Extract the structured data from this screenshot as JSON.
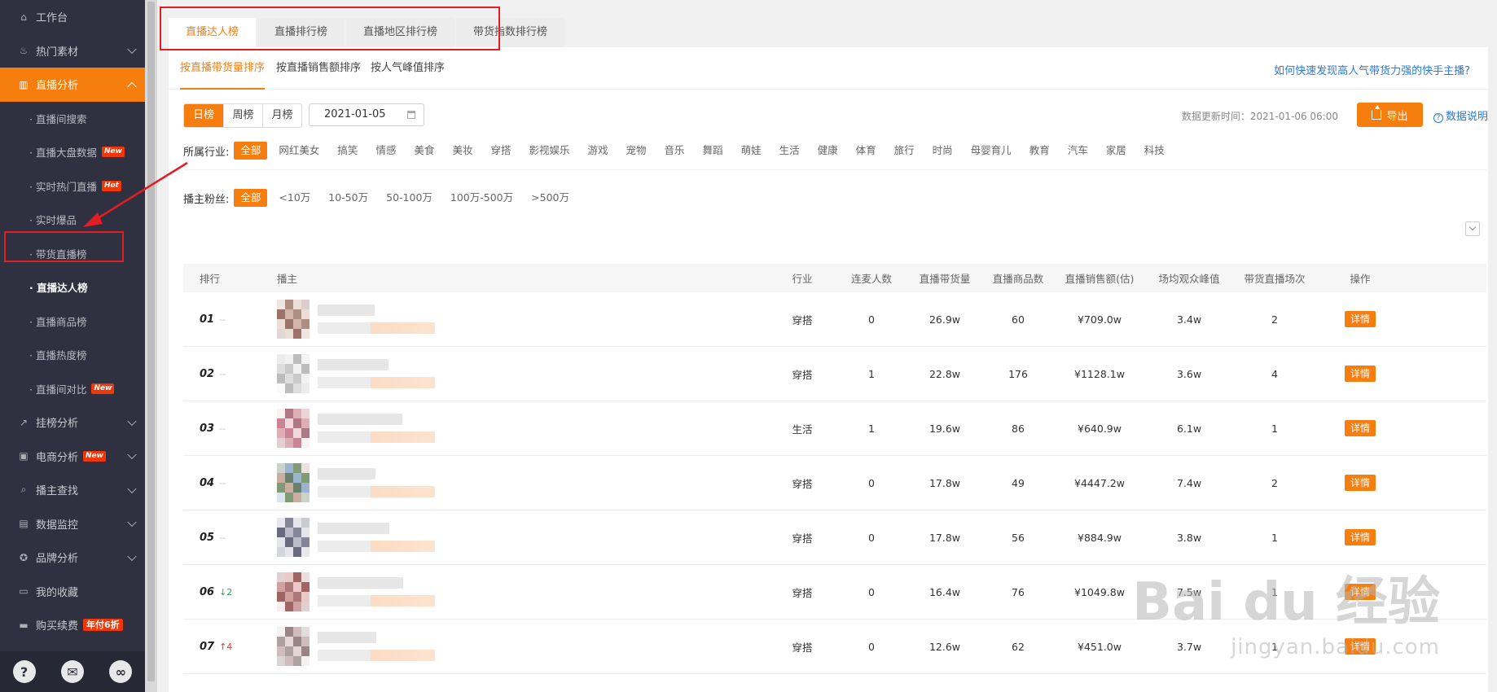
{
  "sidebar": {
    "items": [
      {
        "label": "工作台",
        "icon": "home-icon",
        "glyph": "⌂"
      },
      {
        "label": "热门素材",
        "icon": "flame-icon",
        "glyph": "♨",
        "chevron": true
      },
      {
        "label": "直播分析",
        "icon": "bar-chart-icon",
        "glyph": "▥",
        "chevron": true,
        "active": true
      }
    ],
    "subitems": [
      {
        "label": "· 直播间搜索"
      },
      {
        "label": "· 直播大盘数据",
        "badge": "New"
      },
      {
        "label": "· 实时热门直播",
        "badge": "Hot"
      },
      {
        "label": "· 实时爆品"
      },
      {
        "label": "· 带货直播榜"
      },
      {
        "label": "· 直播达人榜",
        "current": true
      },
      {
        "label": "· 直播商品榜"
      },
      {
        "label": "· 直播热度榜"
      },
      {
        "label": "· 直播间对比",
        "badge": "New"
      }
    ],
    "items2": [
      {
        "label": "挂榜分析",
        "icon": "trend-icon",
        "glyph": "↗",
        "chevron": true
      },
      {
        "label": "电商分析",
        "icon": "bag-icon",
        "glyph": "▣",
        "chevron": true,
        "badge": "New"
      },
      {
        "label": "播主查找",
        "icon": "search-icon",
        "glyph": "⌕",
        "chevron": true
      },
      {
        "label": "数据监控",
        "icon": "monitor-icon",
        "glyph": "▤",
        "chevron": true
      },
      {
        "label": "品牌分析",
        "icon": "brand-icon",
        "glyph": "✪",
        "chevron": true
      },
      {
        "label": "我的收藏",
        "icon": "folder-icon",
        "glyph": "▭"
      },
      {
        "label": "购买续费",
        "icon": "card-icon",
        "glyph": "▬",
        "badge_big": "年付6折"
      }
    ],
    "footer": [
      {
        "icon": "help-icon",
        "glyph": "?"
      },
      {
        "icon": "wechat-icon",
        "glyph": "✉"
      },
      {
        "icon": "link-icon",
        "glyph": "∞"
      }
    ]
  },
  "top_tabs": [
    "直播达人榜",
    "直播排行榜",
    "直播地区排行榜",
    "带货指数排行榜"
  ],
  "sub_tabs": [
    "按直播带货量排序",
    "按直播销售额排序",
    "按人气峰值排序"
  ],
  "help_link": "如何快速发现高人气带货力强的快手主播?",
  "period_tabs": [
    "日榜",
    "周榜",
    "月榜"
  ],
  "date_value": "2021-01-05",
  "update_time": "数据更新时间：2021-01-06 06:00",
  "export_label": "导出",
  "data_explain": "数据说明",
  "industry": {
    "label": "所属行业:",
    "options": [
      "全部",
      "网红美女",
      "搞笑",
      "情感",
      "美食",
      "美妆",
      "穿搭",
      "影视娱乐",
      "游戏",
      "宠物",
      "音乐",
      "舞蹈",
      "萌娃",
      "生活",
      "健康",
      "体育",
      "旅行",
      "时尚",
      "母婴育儿",
      "教育",
      "汽车",
      "家居",
      "科技"
    ]
  },
  "fans": {
    "label": "播主粉丝:",
    "options": [
      "全部",
      "<10万",
      "10-50万",
      "50-100万",
      "100万-500万",
      ">500万"
    ]
  },
  "table": {
    "headers": [
      "排行",
      "播主",
      "行业",
      "连麦人数",
      "直播带货量",
      "直播商品数",
      "直播销售额(估)",
      "场均观众峰值",
      "带货直播场次",
      "操作"
    ],
    "detail_label": "详情",
    "rows": [
      {
        "rank": "01",
        "change": "--",
        "dir": "",
        "industry": "穿搭",
        "mic": "0",
        "volume": "26.9w",
        "products": "60",
        "sales": "¥709.0w",
        "peak": "3.4w",
        "sessions": "2"
      },
      {
        "rank": "02",
        "change": "--",
        "dir": "",
        "industry": "穿搭",
        "mic": "1",
        "volume": "22.8w",
        "products": "176",
        "sales": "¥1128.1w",
        "peak": "3.6w",
        "sessions": "4"
      },
      {
        "rank": "03",
        "change": "--",
        "dir": "",
        "industry": "生活",
        "mic": "1",
        "volume": "19.6w",
        "products": "86",
        "sales": "¥640.9w",
        "peak": "6.1w",
        "sessions": "1"
      },
      {
        "rank": "04",
        "change": "--",
        "dir": "",
        "industry": "穿搭",
        "mic": "0",
        "volume": "17.8w",
        "products": "49",
        "sales": "¥4447.2w",
        "peak": "7.4w",
        "sessions": "2"
      },
      {
        "rank": "05",
        "change": "--",
        "dir": "",
        "industry": "穿搭",
        "mic": "0",
        "volume": "17.8w",
        "products": "56",
        "sales": "¥884.9w",
        "peak": "3.8w",
        "sessions": "1"
      },
      {
        "rank": "06",
        "change": "↓2",
        "dir": "down",
        "industry": "穿搭",
        "mic": "0",
        "volume": "16.4w",
        "products": "76",
        "sales": "¥1049.8w",
        "peak": "7.5w",
        "sessions": "1"
      },
      {
        "rank": "07",
        "change": "↑4",
        "dir": "up",
        "industry": "穿搭",
        "mic": "0",
        "volume": "12.6w",
        "products": "62",
        "sales": "¥451.0w",
        "peak": "3.7w",
        "sessions": "1"
      }
    ]
  },
  "watermark": {
    "brand": "Bai du 经验",
    "url": "jingyan.baidu.com"
  },
  "colors": {
    "accent": "#f57e0f",
    "sidebar": "#2f3140",
    "link": "#2b7ad6",
    "annotation": "#e51c23"
  }
}
